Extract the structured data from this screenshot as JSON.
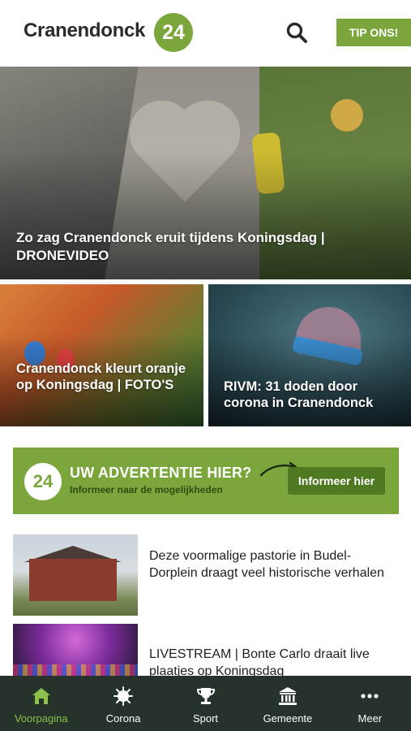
{
  "header": {
    "logo_text": "Cranendonck",
    "logo_badge": "24",
    "tip_button": "TIP ONS!"
  },
  "hero": {
    "title": "Zo zag Cranendonck eruit tijdens Koningsdag | DRONEVIDEO"
  },
  "cards": [
    {
      "title": "Cranendonck kleurt oranje op Koningsdag | FOTO'S"
    },
    {
      "title": "RIVM: 31 doden door corona in Cranendonck"
    }
  ],
  "ad": {
    "badge": "24",
    "title": "UW ADVERTENTIE HIER?",
    "subtitle": "Informeer naar de mogelijkheden",
    "button": "Informeer hier"
  },
  "articles": [
    {
      "title": "Deze voormalige pastorie in Budel-Dorplein draagt veel historische verhalen"
    },
    {
      "title": "LIVESTREAM | Bonte Carlo draait live plaatjes op Koningsdag"
    }
  ],
  "nav": {
    "items": [
      {
        "label": "Voorpagina",
        "icon": "home-icon",
        "active": true
      },
      {
        "label": "Corona",
        "icon": "virus-icon",
        "active": false
      },
      {
        "label": "Sport",
        "icon": "trophy-icon",
        "active": false
      },
      {
        "label": "Gemeente",
        "icon": "town-hall-icon",
        "active": false
      },
      {
        "label": "Meer",
        "icon": "more-icon",
        "active": false
      }
    ]
  },
  "colors": {
    "brand_green": "#7aa63c",
    "nav_background": "#25332a",
    "nav_active": "#8cc04a"
  }
}
